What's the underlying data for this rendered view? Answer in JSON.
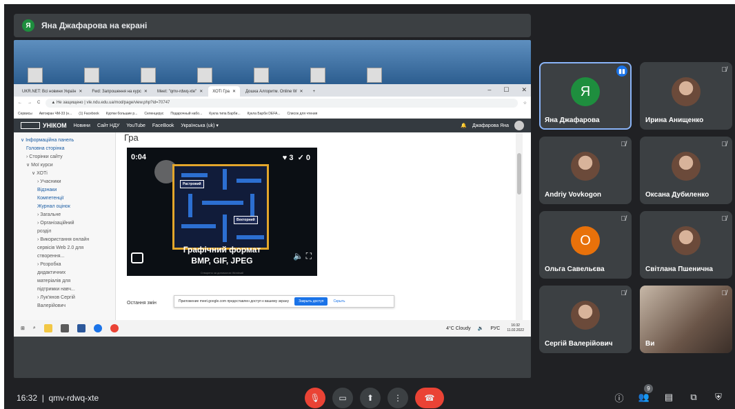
{
  "banner": {
    "avatar_letter": "Я",
    "text": "Яна Джафарова на екрані"
  },
  "browser": {
    "tabs": [
      {
        "label": "UKR.NET: Всі новини Україн"
      },
      {
        "label": "Fwd: Запрошення на курс"
      },
      {
        "label": "Meet: \"qmv-rdwq-xte\""
      },
      {
        "label": "ХОТі Гра"
      },
      {
        "label": "Дошка Алгоритм. Online W"
      }
    ],
    "security_text": "Не защищено",
    "url": "vle.ndu.edu.ua/mod/page/view.php?id=70747",
    "bookmarks": [
      "Сервисы",
      "Автокран ЧМ-33 (н...",
      "(1) Facebook",
      "Куртки большие р...",
      "Селенцерус",
      "Подарочный набо...",
      "Кукла типа Барби...",
      "Кукла Барби DEFA...",
      "Список для чтения"
    ]
  },
  "site": {
    "logo": "УНІКОМ",
    "nav": [
      "Новини",
      "Сайт НДУ",
      "YouTube",
      "FaceBook",
      "Українська (uk) ▾"
    ],
    "user": "Джафарова Яна"
  },
  "sidenav": {
    "items": [
      {
        "label": "∨ Інформаційна панель",
        "level": 1
      },
      {
        "label": "Головна сторінка",
        "level": 2
      },
      {
        "label": "› Сторінки сайту",
        "level": 2
      },
      {
        "label": "∨ Мої курси",
        "level": 2
      },
      {
        "label": "∨ ХОТі",
        "level": 3
      },
      {
        "label": "› Учасники",
        "level": 4
      },
      {
        "label": "Відзнаки",
        "level": 4
      },
      {
        "label": "Компетенції",
        "level": 4
      },
      {
        "label": "Журнал оцінок",
        "level": 4
      },
      {
        "label": "› Загальне",
        "level": 4
      },
      {
        "label": "› Організаційний розділ",
        "level": 4
      },
      {
        "label": "› Використання онлайн сервісів Web 2.0 для створення...",
        "level": 4
      },
      {
        "label": "› Розробка дидактичних матеріалів для підтримки навч...",
        "level": 4
      },
      {
        "label": "› Лук'янов Сергій Валерійович",
        "level": 4
      }
    ]
  },
  "page": {
    "title": "Гра",
    "last_change": "Остання змін"
  },
  "game": {
    "timer": "0:04",
    "lives": "3",
    "checks": "0",
    "label_raster": "Растровий",
    "label_vector": "Векторний",
    "caption_line1": "Графічний формат",
    "caption_line2": "BMP, GIF, JPEG",
    "footer": "Створено за допомогою Wordwall"
  },
  "share_notice": {
    "text": "Приложение meet.google.com предоставлен доступ к вашему экрану",
    "stop": "Закрыть доступ",
    "hide": "Скрыть"
  },
  "taskbar": {
    "weather": "4°C Cloudy",
    "lang": "РУС",
    "time": "16:32",
    "date": "11.02.2022"
  },
  "participants": [
    {
      "name": "Яна Джафарова",
      "type": "letter",
      "letter": "Я",
      "color": "#1e8e3e",
      "active": true,
      "muted": false
    },
    {
      "name": "Ирина Анищенко",
      "type": "photo",
      "muted": true
    },
    {
      "name": "Andriy Vovkogon",
      "type": "photo",
      "muted": true
    },
    {
      "name": "Оксана Дубиленко",
      "type": "photo",
      "muted": true
    },
    {
      "name": "Ольга Савельєва",
      "type": "letter",
      "letter": "О",
      "color": "#e8710a",
      "muted": true
    },
    {
      "name": "Світлана Пшенична",
      "type": "photo",
      "muted": true
    },
    {
      "name": "Сергій Валерійович",
      "type": "photo",
      "muted": true
    },
    {
      "name": "Ви",
      "type": "video",
      "muted": true
    }
  ],
  "meeting": {
    "time": "16:32",
    "separator": "|",
    "code": "qmv-rdwq-xte"
  },
  "people_count": "9"
}
